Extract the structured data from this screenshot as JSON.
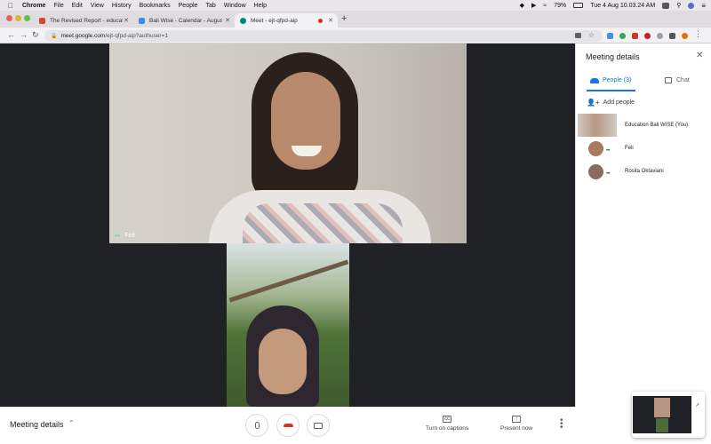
{
  "menubar": {
    "app": "Chrome",
    "items": [
      "File",
      "Edit",
      "View",
      "History",
      "Bookmarks",
      "People",
      "Tab",
      "Window",
      "Help"
    ],
    "battery": "79%",
    "clock": "Tue 4 Aug  10.03.24 AM"
  },
  "tabs": [
    {
      "title": "The Revised Report - educatio",
      "color": "#db4437"
    },
    {
      "title": "Bali Wise - Calendar - August",
      "color": "#4285f4"
    },
    {
      "title": "Meet - ejt-qfpd-aip",
      "color": "#00897b"
    }
  ],
  "address": {
    "domain": "meet.google.com",
    "path": "/ejt-qfpd-aip?authuser=1"
  },
  "video": {
    "main_participant": "Feli"
  },
  "bottom": {
    "meeting_details": "Meeting details",
    "captions": "Turn on captions",
    "present": "Present now"
  },
  "panel": {
    "title": "Meeting details",
    "people_tab": "People (3)",
    "chat_tab": "Chat",
    "add_people": "Add people",
    "people": [
      {
        "name": "Education Bali WISE (You)"
      },
      {
        "name": "Feli"
      },
      {
        "name": "Rosita Oktaviani"
      }
    ]
  },
  "colors": {
    "accent": "#1a73e8",
    "hangup": "#d93025",
    "speaking": "#1e8e3e"
  }
}
